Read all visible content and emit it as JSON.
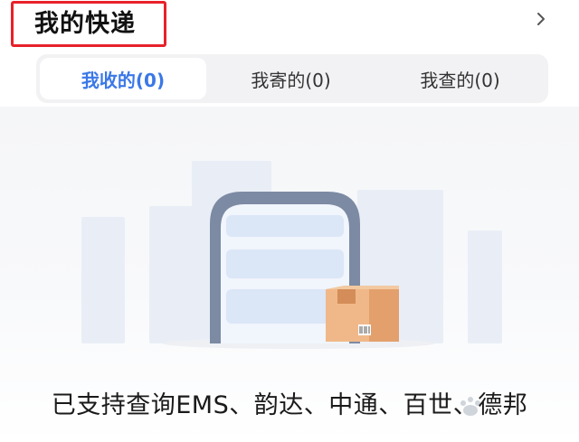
{
  "header": {
    "title": "我的快递"
  },
  "tabs": [
    {
      "label": "我收的(0)",
      "active": true
    },
    {
      "label": "我寄的(0)",
      "active": false
    },
    {
      "label": "我查的(0)",
      "active": false
    }
  ],
  "empty_state": {
    "support_text": "已支持查询EMS、韵达、中通、百世、德邦"
  },
  "icons": {
    "chevron": "chevron-right-icon",
    "illustration": "phone-package-illustration"
  },
  "colors": {
    "accent": "#3b78e7",
    "highlight": "#e8212a",
    "tab_bg": "#f2f2f4"
  }
}
